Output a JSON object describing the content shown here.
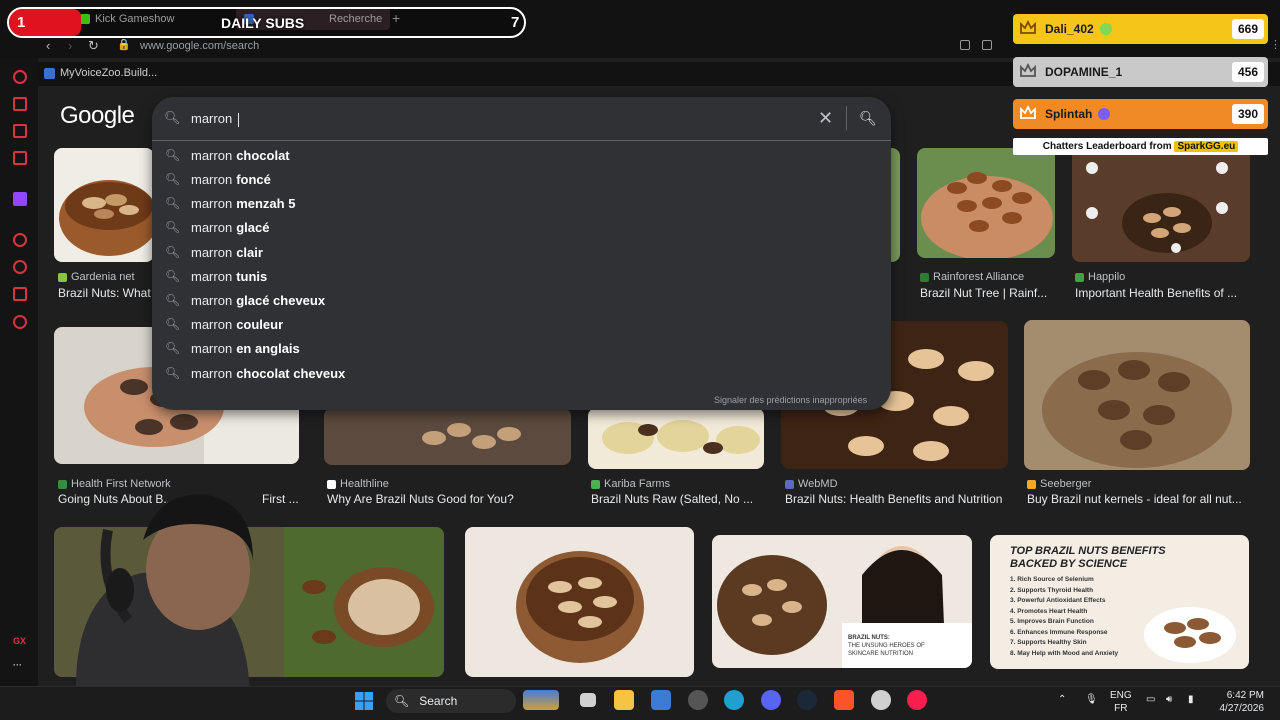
{
  "browser": {
    "tabs": [
      {
        "label": "Kick Gameshow"
      },
      {
        "label": "Recherche"
      }
    ],
    "url": "www.google.com/search",
    "bookmark": "MyVoiceZoo.Build..."
  },
  "sidebar": {
    "gx_label": "GX"
  },
  "google": {
    "logo": "Google",
    "query": "marron ",
    "report_link": "Signaler des prédictions inappropriées",
    "suggestions": [
      {
        "prefix": "marron",
        "bold": "chocolat"
      },
      {
        "prefix": "marron",
        "bold": "foncé"
      },
      {
        "prefix": "marron",
        "bold": "menzah 5"
      },
      {
        "prefix": "marron",
        "bold": "glacé"
      },
      {
        "prefix": "marron",
        "bold": "clair"
      },
      {
        "prefix": "marron",
        "bold": "tunis"
      },
      {
        "prefix": "marron",
        "bold": "glacé cheveux"
      },
      {
        "prefix": "marron",
        "bold": "couleur"
      },
      {
        "prefix": "marron",
        "bold": "en anglais"
      },
      {
        "prefix": "marron",
        "bold": "chocolat cheveux"
      }
    ]
  },
  "results": [
    {
      "source": "Gardenia net",
      "caption": "Brazil Nuts: What",
      "fav": "#8bc34a"
    },
    {
      "source": "Rainforest Alliance",
      "caption": "Brazil Nut Tree | Rainf...",
      "fav": "#2e7d32"
    },
    {
      "source": "Happilo",
      "caption": "Important Health Benefits of ...",
      "fav": "#43a047"
    },
    {
      "source": "Health First Network",
      "caption": "Going Nuts About B...",
      "caption2": "First ...",
      "fav": "#388e3c"
    },
    {
      "source": "Healthline",
      "caption": "Why Are Brazil Nuts Good for You?",
      "fav": "#ffffff"
    },
    {
      "source": "Kariba Farms",
      "caption": "Brazil Nuts Raw (Salted, No ...",
      "fav": "#4caf50"
    },
    {
      "source": "WebMD",
      "caption": "Brazil Nuts: Health Benefits and Nutrition",
      "fav": "#5c6bc0"
    },
    {
      "source": "Seeberger",
      "caption": "Buy Brazil nut kernels - ideal for all nut...",
      "fav": "#f9a825"
    }
  ],
  "infographic": {
    "title": "TOP BRAZIL NUTS BENEFITS BACKED BY SCIENCE",
    "items": [
      "1. Rich Source of Selenium",
      "2. Supports Thyroid Health",
      "3. Powerful Antioxidant Effects",
      "4. Promotes Heart Health",
      "5. Improves Brain Function",
      "6. Enhances Immune Response",
      "7. Supports Healthy Skin",
      "8. May Help with Mood and Anxiety"
    ]
  },
  "skincare_tile": {
    "line1": "BRAZIL NUTS:",
    "line2": "THE UNSUNG HEROES OF",
    "line3": "SKINCARE NUTRITION"
  },
  "overlay": {
    "daily_subs": {
      "left": "1",
      "label": "DAILY SUBS",
      "right": "7"
    },
    "leaderboard": [
      {
        "name": "Dali_402",
        "score": "669",
        "color": "#f5c518",
        "badge": "#7ed957"
      },
      {
        "name": "DOPAMINE_1",
        "score": "456",
        "color": "#c9c9c9",
        "badge": ""
      },
      {
        "name": "Splintah",
        "score": "390",
        "color": "#f08a24",
        "badge": "#7b5cff"
      }
    ],
    "leaderboard_footer": "Chatters Leaderboard from",
    "leaderboard_brand": "SparkGG.eu"
  },
  "taskbar": {
    "search_label": "Search",
    "lang1": "ENG",
    "lang2": "FR",
    "time": "6:42 PM",
    "date": "4/27/2026"
  }
}
